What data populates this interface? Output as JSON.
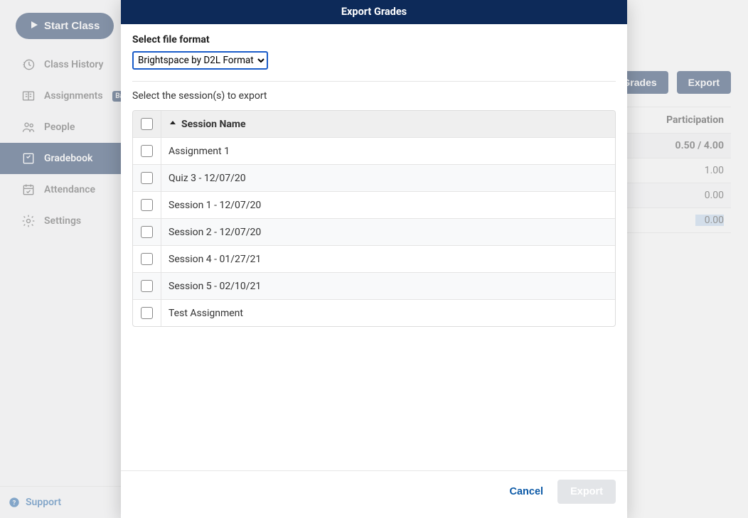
{
  "sidebar": {
    "start_class": "Start Class",
    "items": [
      {
        "label": "Class History"
      },
      {
        "label": "Assignments",
        "badge": "Ba"
      },
      {
        "label": "People"
      },
      {
        "label": "Gradebook"
      },
      {
        "label": "Attendance"
      },
      {
        "label": "Settings"
      }
    ],
    "support": "Support"
  },
  "main": {
    "buttons": {
      "grades": "Grades",
      "export": "Export"
    },
    "table": {
      "header": "Participation",
      "total": "0.50 / 4.00",
      "rows": [
        "1.00",
        "0.00",
        "0.00"
      ]
    }
  },
  "modal": {
    "title": "Export Grades",
    "file_format_label": "Select file format",
    "file_format_value": "Brightspace by D2L Format",
    "sessions_label": "Select the session(s) to export",
    "session_header": "Session Name",
    "sessions": [
      "Assignment 1",
      "Quiz 3 - 12/07/20",
      "Session 1 - 12/07/20",
      "Session 2 - 12/07/20",
      "Session 4 - 01/27/21",
      "Session 5 - 02/10/21",
      "Test Assignment"
    ],
    "footer": {
      "cancel": "Cancel",
      "export": "Export"
    }
  }
}
